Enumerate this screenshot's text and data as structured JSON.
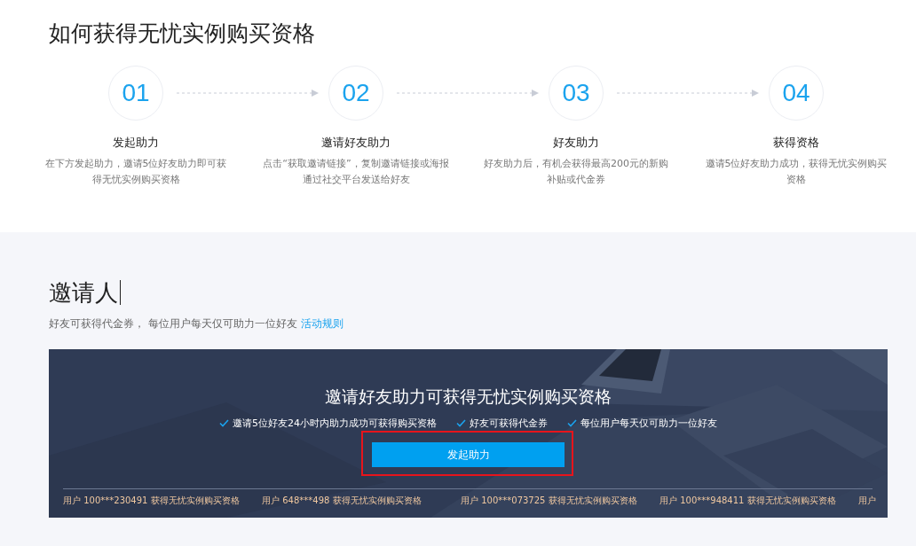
{
  "steps_section": {
    "title": "如何获得无忧实例购买资格",
    "steps": [
      {
        "number": "01",
        "title": "发起助力",
        "description": "在下方发起助力，邀请5位好友助力即可获得无忧实例购买资格"
      },
      {
        "number": "02",
        "title": "邀请好友助力",
        "description": "点击“获取邀请链接”，复制邀请链接或海报通过社交平台发送给好友"
      },
      {
        "number": "03",
        "title": "好友助力",
        "description": "好友助力后，有机会获得最高200元的新购补贴或代金券"
      },
      {
        "number": "04",
        "title": "获得资格",
        "description": "邀请5位好友助力成功，获得无忧实例购买资格"
      }
    ]
  },
  "inviter_section": {
    "title": "邀请人",
    "subtitle": "好友可获得代金券， 每位用户每天仅可助力一位好友",
    "rules_link": "活动规则",
    "banner": {
      "kind": "picture",
      "title": "邀请好友助力可获得无忧实例购买资格",
      "benefits": [
        "邀请5位好友24小时内助力成功可获得购买资格",
        "好友可获得代金券",
        "每位用户每天仅可助力一位好友"
      ],
      "button": "发起助力",
      "button_highlighted": true,
      "ticker": [
        "用户 100***230491 获得无忧实例购买资格",
        "用户 648***498 获得无忧实例购买资格",
        "用户 100***073725 获得无忧实例购买资格",
        "用户 100***948411 获得无忧实例购买资格",
        "用户"
      ]
    }
  }
}
